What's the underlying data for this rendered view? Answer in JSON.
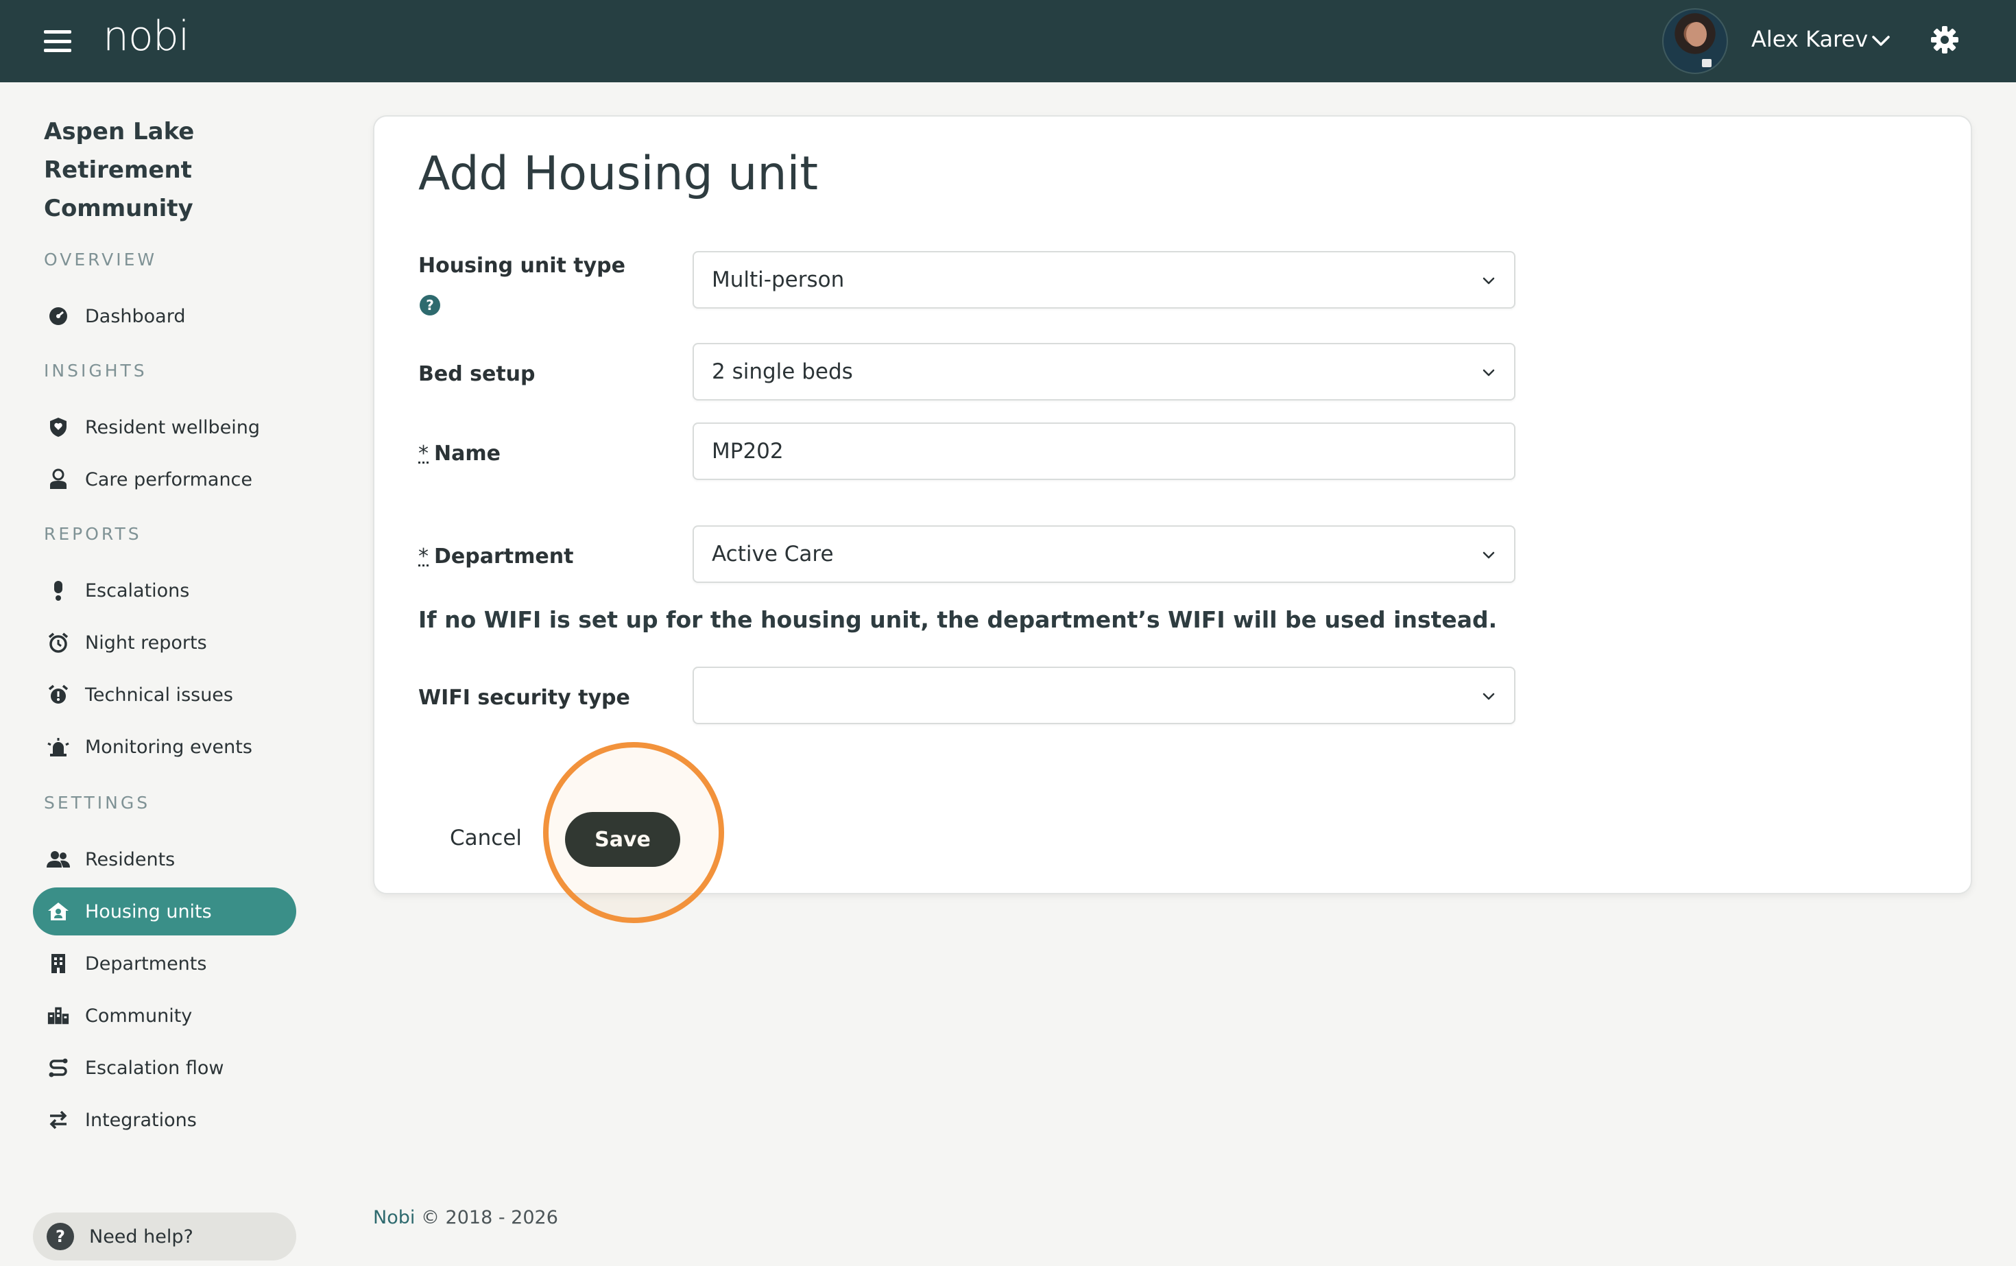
{
  "app": {
    "logo_text": "nobi",
    "user_name": "Alex Karev",
    "colors": {
      "topbar": "#263f42",
      "accent": "#3a8f88",
      "highlight": "#f2923b"
    }
  },
  "sidebar": {
    "org_name": "Aspen Lake Retirement Community",
    "sections": {
      "overview": "OVERVIEW",
      "insights": "INSIGHTS",
      "reports": "REPORTS",
      "settings": "SETTINGS"
    },
    "items": {
      "dashboard": "Dashboard",
      "resident_wellbeing": "Resident wellbeing",
      "care_performance": "Care performance",
      "escalations": "Escalations",
      "night_reports": "Night reports",
      "technical_issues": "Technical issues",
      "monitoring_events": "Monitoring events",
      "residents": "Residents",
      "housing_units": "Housing units",
      "departments": "Departments",
      "community": "Community",
      "escalation_flow": "Escalation flow",
      "integrations": "Integrations"
    },
    "active_item": "Housing units",
    "help": "Need help?"
  },
  "form": {
    "title": "Add Housing unit",
    "housing_unit_type": {
      "label": "Housing unit type",
      "value": "Multi-person"
    },
    "bed_setup": {
      "label": "Bed setup",
      "value": "2 single beds"
    },
    "name": {
      "required_mark": "*",
      "label": "Name",
      "value": "MP202"
    },
    "department": {
      "required_mark": "*",
      "label": "Department",
      "value": "Active Care"
    },
    "wifi_notice": "If no WIFI is set up for the housing unit, the department’s WIFI will be used instead.",
    "wifi_security_type": {
      "label": "WIFI security type",
      "value": ""
    },
    "cancel_label": "Cancel",
    "save_label": "Save"
  },
  "footer": {
    "brand": "Nobi",
    "copyright": "© 2018 - 2026"
  }
}
